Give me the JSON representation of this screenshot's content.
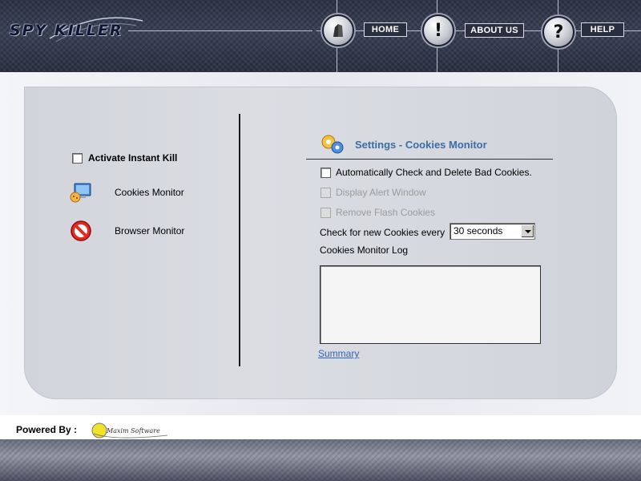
{
  "app": {
    "logo_text": "SPY KILLER"
  },
  "nav": {
    "home": "HOME",
    "about": "ABOUT US",
    "help": "HELP"
  },
  "sidebar": {
    "instant_kill_label": "Activate Instant Kill",
    "instant_kill_checked": false,
    "items": [
      {
        "label": "Cookies Monitor",
        "icon": "cookies-monitor-icon"
      },
      {
        "label": "Browser Monitor",
        "icon": "browser-monitor-icon"
      }
    ]
  },
  "settings": {
    "title": "Settings - Cookies Monitor",
    "options": [
      {
        "label": "Automatically Check and Delete Bad Cookies.",
        "checked": false,
        "enabled": true
      },
      {
        "label": "Display Alert Window",
        "checked": false,
        "enabled": false
      },
      {
        "label": "Remove Flash Cookies",
        "checked": false,
        "enabled": false
      }
    ],
    "check_every_label": "Check for new Cookies every",
    "interval_value": "30 seconds",
    "log_label": "Cookies Monitor Log",
    "log_content": "",
    "summary_link": "Summary"
  },
  "footer": {
    "powered_by": "Powered By :",
    "company": "Maxim Software"
  },
  "colors": {
    "header_bg": "#333a4e",
    "accent_title": "#3a6ea5",
    "link": "#3464b0"
  }
}
